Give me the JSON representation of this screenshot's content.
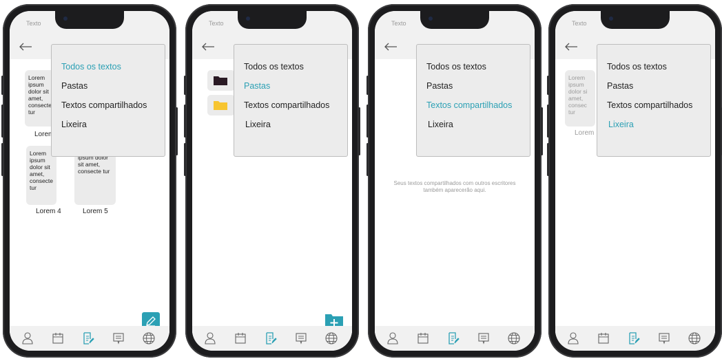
{
  "status_title": "Texto",
  "menu": {
    "items": [
      "Todos os textos",
      "Pastas",
      "Textos compartilhados",
      "Lixeira"
    ]
  },
  "screens": [
    {
      "active_menu": 0,
      "cards": [
        {
          "text": "Lorem ipsum dolor sit amet, consecte tur",
          "label": "Lorem"
        },
        {
          "text": "Lorem ipsum dolor sit amet, consecte tur",
          "label": "Lorem 4"
        },
        {
          "text": "ipsum dolor sit amet, consecte tur",
          "label": "Lorem 5"
        }
      ]
    },
    {
      "active_menu": 1
    },
    {
      "active_menu": 2,
      "empty_message": "Seus textos compartilhados com outros escritores também aparecerão aqui."
    },
    {
      "active_menu": 3,
      "cards": [
        {
          "text": "Lorem ipsum dolor si amet, consec tur",
          "label": "Lorem"
        }
      ]
    }
  ],
  "icons": {
    "back": "arrow-left-icon",
    "tabs": [
      "profile-icon",
      "calendar-icon",
      "document-edit-icon",
      "chat-icon",
      "globe-icon"
    ],
    "fab_write": "pencil-icon",
    "fab_folder": "folder-plus-icon"
  },
  "colors": {
    "accent": "#2ba0b4",
    "folder_dark": "#2a1a24",
    "folder_yellow": "#f7c531",
    "menu_bg": "#ececec",
    "bar_bg": "#f1f1f1"
  }
}
